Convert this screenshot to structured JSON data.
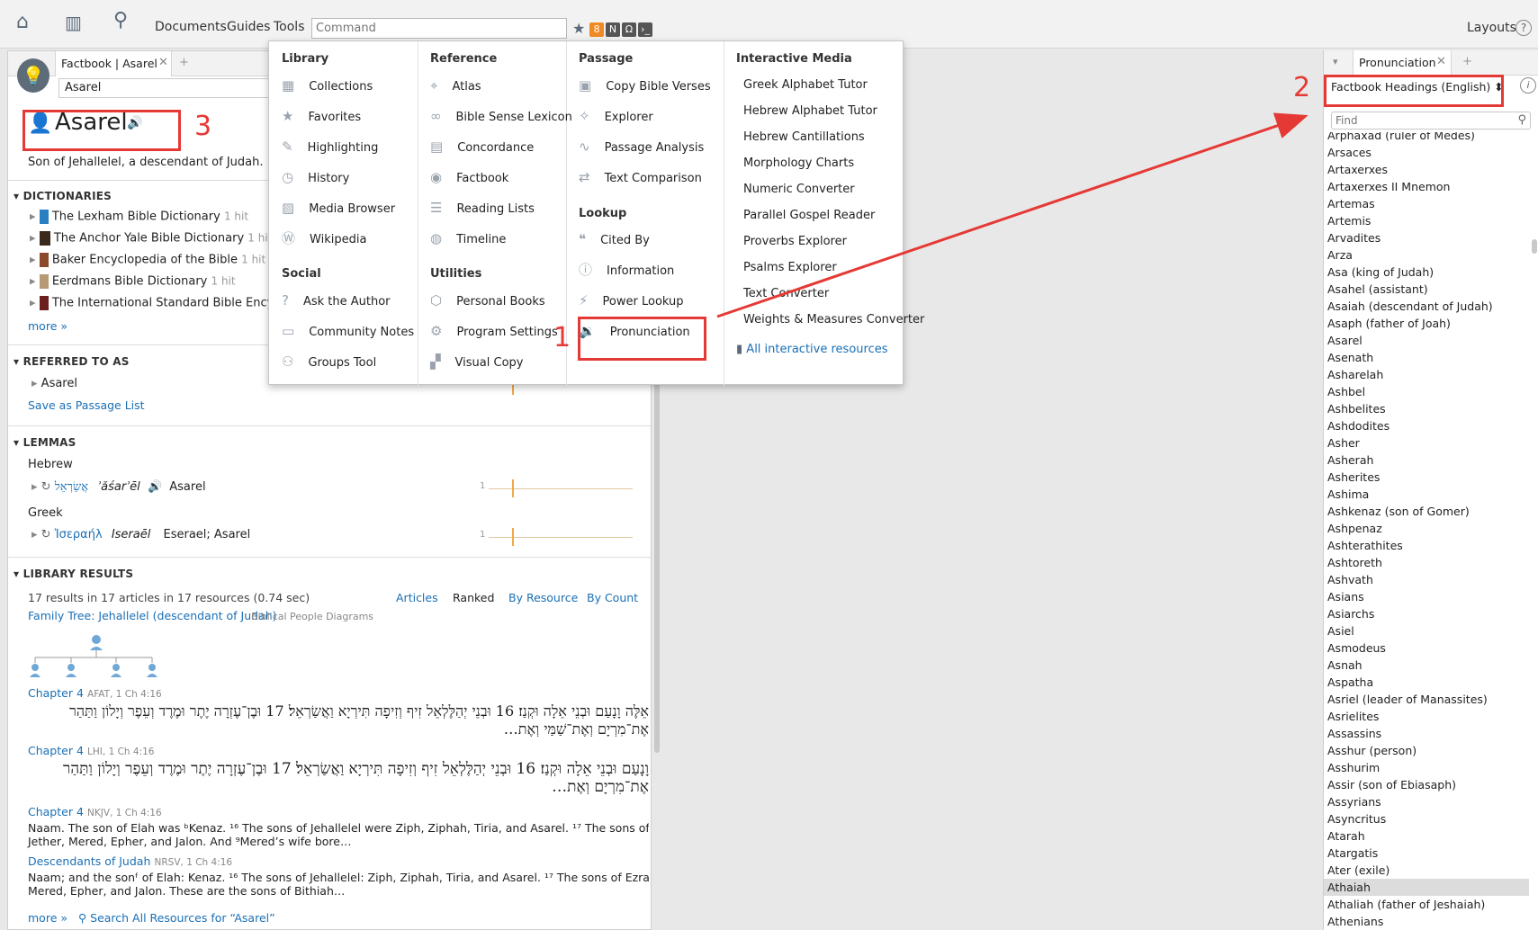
{
  "toolbar": {
    "home_icon": "home-icon",
    "library_icon": "book-icon",
    "search_icon": "search-icon",
    "menus": [
      "Documents",
      "Guides",
      "Tools"
    ],
    "command_placeholder": "Command",
    "layouts_label": "Layouts",
    "help_glyph": "?"
  },
  "factbook": {
    "tab_label": "Factbook | Asarel",
    "search_value": "Asarel",
    "title": "Asarel",
    "description": "Son of Jehallelel, a descendant of Judah.",
    "dictionaries_header": "DICTIONARIES",
    "dictionaries": [
      {
        "name": "The Lexham Bible Dictionary",
        "hits": "1 hit"
      },
      {
        "name": "The Anchor Yale Bible Dictionary",
        "hits": "1 hit"
      },
      {
        "name": "Baker Encyclopedia of the Bible",
        "hits": "1 hit"
      },
      {
        "name": "Eerdmans Bible Dictionary",
        "hits": "1 hit"
      },
      {
        "name": "The International Standard Bible Encyclop",
        "hits": ""
      }
    ],
    "more": "more »",
    "referred_header": "REFERRED TO AS",
    "referred_item": "Asarel",
    "save_passage": "Save as Passage List",
    "lemmas_header": "LEMMAS",
    "hebrew_label": "Hebrew",
    "hebrew_lemma": "אֲשַׂרְאֵל",
    "hebrew_translit": "ʾăśarʾēl",
    "hebrew_gloss": "Asarel",
    "greek_label": "Greek",
    "greek_lemma": "Ἰσεραήλ",
    "greek_translit": "Iseraēl",
    "greek_gloss": "Eserael; Asarel",
    "chart_count": "1",
    "library_header": "LIBRARY RESULTS",
    "results_summary": "17 results in 17 articles in 17 resources (0.74 sec)",
    "views": [
      "Articles",
      "Ranked",
      "By Resource",
      "By Count"
    ],
    "family_tree_link": "Family Tree: Jehallelel (descendant of Judah)",
    "family_tree_src": "Biblical People Diagrams",
    "results": [
      {
        "title": "Chapter 4",
        "src": "AFAT, 1 Ch 4:16",
        "line1": "אֵלֶּה וָנָעַם וּבְנֵי אֵלָה וּקְנַז׃ 16 וּבְנֵי יְהַלֶּלְאֵל זִיף וְזִיפָה תִּירְיָא וַאֲשַׂרְאֵל׃ 17 וּבֶן־עֶזְרָה יֶתֶר וּמֶרֶד וְעֵפֶר וְיָלוֹן וַתַּהַר",
        "line2": "אֶת־מִרְיָם וְאֶת־שַׁמַּי וְאֶת…"
      },
      {
        "title": "Chapter 4",
        "src": "LHI, 1 Ch 4:16",
        "line1": "וָנָעַם וּבְנֵי אֵלָה וּקְנַז׃ 16 וּבְנֵי יְהַלֶּלְאֵל זִיף וְזִיפָה תִּירְיָא וַאֲשַׂרְאֵל׃ 17 וּבֶן־עֶזְרָה יֶתֶר וּמֶרֶד וְעֵפֶר וְיָלוֹן וַתַּהַר",
        "line2": "אֶת־מִרְיָם וְאֶת…"
      },
      {
        "title": "Chapter 4",
        "src": "NKJV, 1 Ch 4:16",
        "line1": "Naam. The son of Elah was ᵇKenaz. ¹⁶ The sons of Jehallelel were Ziph, Ziphah, Tiria, and Asarel. ¹⁷ The sons of Ezrah were",
        "line2": "Jether, Mered, Epher, and Jalon. And ⁹Mered’s wife bore…"
      },
      {
        "title": "Descendants of Judah",
        "src": "NRSV, 1 Ch 4:16",
        "line1": "Naam; and the sonᶠ of Elah: Kenaz. ¹⁶ The sons of Jehallelel: Ziph, Ziphah, Tiria, and Asarel. ¹⁷ The sons of Ezrah: Jether,",
        "line2": "Mered, Epher, and Jalon. These are the sons of Bithiah…"
      }
    ],
    "search_all": "Search All Resources for “Asarel”"
  },
  "tools_menu": {
    "library_header": "Library",
    "library": [
      "Collections",
      "Favorites",
      "Highlighting",
      "History",
      "Media Browser",
      "Wikipedia"
    ],
    "social_header": "Social",
    "social": [
      "Ask the Author",
      "Community Notes",
      "Groups Tool"
    ],
    "reference_header": "Reference",
    "reference": [
      "Atlas",
      "Bible Sense Lexicon",
      "Concordance",
      "Factbook",
      "Reading Lists",
      "Timeline"
    ],
    "utilities_header": "Utilities",
    "utilities": [
      "Personal Books",
      "Program Settings",
      "Visual Copy"
    ],
    "passage_header": "Passage",
    "passage": [
      "Copy Bible Verses",
      "Explorer",
      "Passage Analysis",
      "Text Comparison"
    ],
    "lookup_header": "Lookup",
    "lookup": [
      "Cited By",
      "Information",
      "Power Lookup",
      "Pronunciation"
    ],
    "interactive_header": "Interactive Media",
    "interactive": [
      "Greek Alphabet Tutor",
      "Hebrew Alphabet Tutor",
      "Hebrew Cantillations",
      "Morphology Charts",
      "Numeric Converter",
      "Parallel Gospel Reader",
      "Proverbs Explorer",
      "Psalms Explorer",
      "Text Converter",
      "Weights & Measures Converter"
    ],
    "all_interactive": "All interactive resources"
  },
  "pronunciation": {
    "tab_label": "Pronunciation",
    "dropdown": "Factbook Headings (English) ⬍",
    "find_placeholder": "Find",
    "partial_top": "Arphaxad (ruler of Medes)",
    "items": [
      "Arsaces",
      "Artaxerxes",
      "Artaxerxes II Mnemon",
      "Artemas",
      "Artemis",
      "Arvadites",
      "Arza",
      "Asa (king of Judah)",
      "Asahel (assistant)",
      "Asaiah (descendant of Judah)",
      "Asaph (father of Joah)",
      "Asarel",
      "Asenath",
      "Asharelah",
      "Ashbel",
      "Ashbelites",
      "Ashdodites",
      "Asher",
      "Asherah",
      "Asherites",
      "Ashima",
      "Ashkenaz (son of Gomer)",
      "Ashpenaz",
      "Ashterathites",
      "Ashtoreth",
      "Ashvath",
      "Asians",
      "Asiarchs",
      "Asiel",
      "Asmodeus",
      "Asnah",
      "Aspatha",
      "Asriel (leader of Manassites)",
      "Asrielites",
      "Assassins",
      "Asshur (person)",
      "Asshurim",
      "Assir (son of Ebiasaph)",
      "Assyrians",
      "Asyncritus",
      "Atarah",
      "Atargatis",
      "Ater (exile)",
      "Athaiah",
      "Athaliah (father of Jeshaiah)",
      "Athenians"
    ],
    "selected": "Athaiah"
  },
  "annotations": {
    "one": "1",
    "two": "2",
    "three": "3"
  },
  "colors": {
    "accent_link": "#1a6fb5",
    "annotation_red": "#e53935",
    "highlight": "#fde7b2"
  }
}
